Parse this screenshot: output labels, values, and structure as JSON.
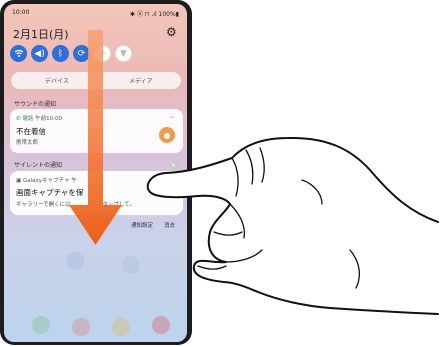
{
  "status_bar": {
    "time": "10:00",
    "right": "✱ ⓓ ⊓ .ıl 100%▮"
  },
  "date": "2月1日(月)",
  "quick_settings": {
    "icons": [
      "wifi-icon",
      "sound-icon",
      "bluetooth-icon",
      "rotate-icon",
      "airplane-icon",
      "flashlight-icon"
    ]
  },
  "output_pills": {
    "device": "デバイス",
    "media": "メディア"
  },
  "sections": {
    "sound": "サウンドの通知",
    "silent": "サイレントの通知"
  },
  "call_notification": {
    "app": "電話",
    "time": "午前10:00",
    "title": "不在着信",
    "caller": "携帯太郎"
  },
  "capture_notification": {
    "app": "Galaxyキャプチャ",
    "time": "午",
    "title": "画面キャプチャを保",
    "body": "ギャラリーで開くには",
    "body_tail": "タップして。"
  },
  "notification_actions": {
    "settings": "通知設定",
    "clear": "消去"
  },
  "colors": {
    "accent": "#2f6fd6",
    "arrow": "#f26a1b",
    "call_button": "#f09a4a"
  }
}
